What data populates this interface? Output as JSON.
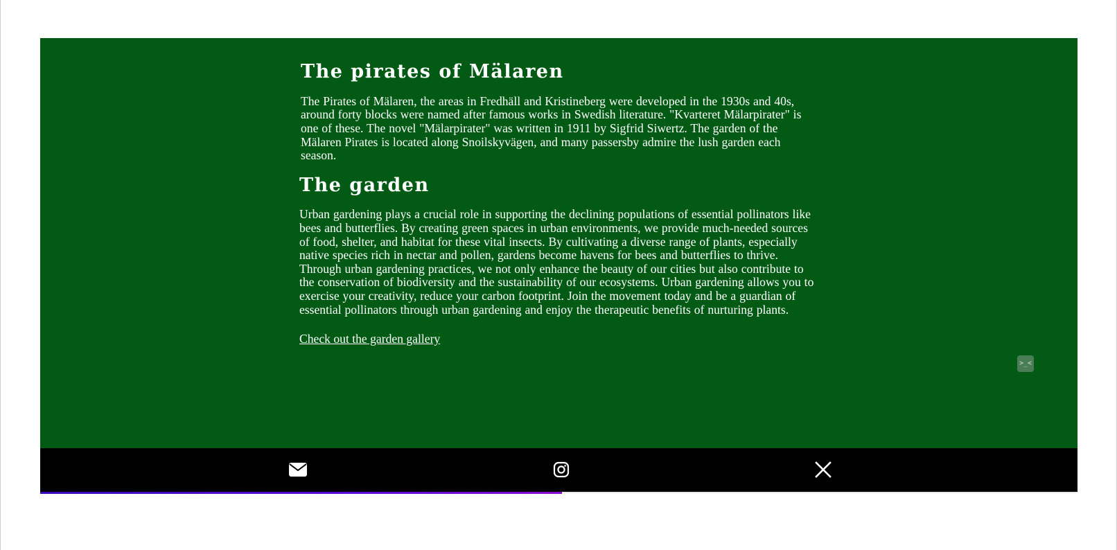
{
  "section_pirates": {
    "title": "The pirates of Mälaren",
    "body": "The Pirates of Mälaren, the areas in Fredhäll and Kristineberg were developed in the 1930s and 40s, around forty blocks were named after famous works in Swedish literature. \"Kvarteret Mälarpirater\" is one of these. The novel \"Mälarpirater\" was written in 1911 by Sigfrid Siwertz. The garden of the Mälaren Pirates is located along Snoilskyvägen, and many passersby admire the lush garden each season."
  },
  "section_garden": {
    "title": "The garden",
    "body": "Urban gardening plays a crucial role in supporting the declining populations of essential pollinators like bees and butterflies. By creating green spaces in urban environments, we provide much-needed sources of food, shelter, and habitat for these vital insects. By cultivating a diverse range of plants, especially native species rich in nectar and pollen, gardens become havens for bees and butterflies to thrive. Through urban gardening practices, we not only enhance the beauty of our cities but also contribute to the conservation of biodiversity and the sustainability of our ecosystems. Urban gardening allows you to exercise your creativity, reduce your carbon footprint. Join the movement today and be a guardian of essential pollinators through urban gardening and enjoy the therapeutic benefits of nurturing plants.",
    "link_label": "Check out the garden gallery"
  },
  "devtools_badge": {
    "label": ">_<"
  },
  "footer": {
    "icons": [
      "mail-icon",
      "instagram-icon",
      "x-logo-icon"
    ]
  },
  "colors": {
    "panel_background": "#025a14",
    "footer_background": "#000000",
    "text": "#ffffff"
  }
}
